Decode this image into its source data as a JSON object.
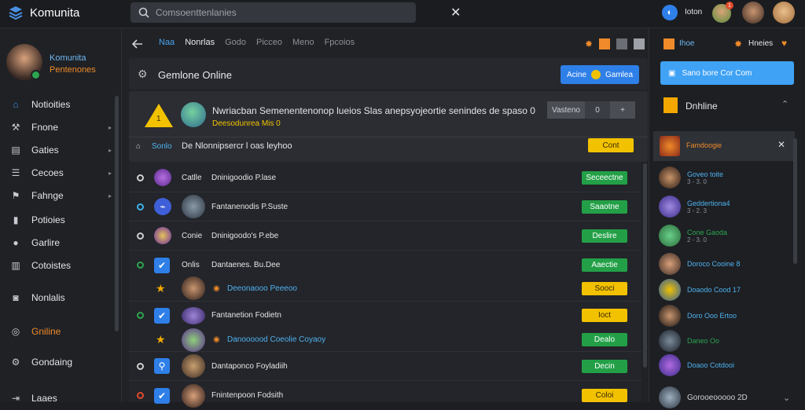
{
  "app": {
    "title": "Komunita"
  },
  "search": {
    "placeholder": "Comsoenttenlanies"
  },
  "top": {
    "user_label": "Ioton",
    "badge": "1"
  },
  "sidebar": {
    "profile": {
      "name": "Komunita",
      "sub": "Pentenones"
    },
    "items": [
      {
        "label": "Notioities",
        "icon": "home-icon"
      },
      {
        "label": "Fnone",
        "icon": "tools-icon"
      },
      {
        "label": "Gaties",
        "icon": "file-icon"
      },
      {
        "label": "Cecoes",
        "icon": "list-icon"
      },
      {
        "label": "Fahnge",
        "icon": "flag-icon"
      },
      {
        "label": "Potioies",
        "icon": "document-icon"
      },
      {
        "label": "Garlire",
        "icon": "drop-icon"
      },
      {
        "label": "Cotoistes",
        "icon": "folder-icon"
      },
      {
        "label": "Nonlalis",
        "icon": "chat-icon"
      },
      {
        "label": "Gniline",
        "icon": "globe-icon"
      },
      {
        "label": "Gondaing",
        "icon": "gear-icon"
      },
      {
        "label": "Laaes",
        "icon": "exit-icon"
      }
    ]
  },
  "main": {
    "tabs": [
      "Naa",
      "Nonrlas",
      "Godo",
      "Picceo",
      "Meno",
      "Fpcoios"
    ],
    "header": {
      "title": "Gemlone Online",
      "button": "Acine",
      "button_suffix": "Gamlea"
    },
    "featured": {
      "title": "Nwriacban Semenentenonop lueios Slas anepsyojeortie senindes de spaso 0",
      "sub": "Deesodunrea Mis 0",
      "stepper": {
        "left": "Vasteno",
        "value": "0",
        "right": "+"
      },
      "badge": "1"
    },
    "infoline": {
      "label": "Sonlo",
      "text": "De Nlonnipsercr l oas leyhoo",
      "btn": "Cont"
    },
    "rows": [
      {
        "title": "Catlle",
        "desc": "Dninigoodio P.lase",
        "btn": "Seceectne",
        "btn_color": "green",
        "marker": "ring"
      },
      {
        "title": "",
        "desc": "Fantanenodis P.Suste",
        "btn": "Saaotne",
        "btn_color": "green",
        "marker": "ring-blue"
      },
      {
        "title": "Conie",
        "desc": "Dninigoodo's P.ebe",
        "btn": "Deslire",
        "btn_color": "green",
        "marker": "ring"
      },
      {
        "title": "Onlis",
        "desc": "Dantaenes. Bu.Dee",
        "btn": "Aaectie",
        "btn_color": "green",
        "marker": "ring-green"
      },
      {
        "title": "",
        "desc": "Deeonaooo Peeeoo",
        "btn": "Sooci",
        "btn_color": "yellow",
        "marker": "star"
      },
      {
        "title": "",
        "desc": "Fantanetion Fodietn",
        "btn": "Ioct",
        "btn_color": "yellow",
        "marker": "ring-green"
      },
      {
        "title": "",
        "desc": "Danoooood Coeolie Coyaoy",
        "btn": "Dealo",
        "btn_color": "green",
        "marker": "star"
      },
      {
        "title": "",
        "desc": "Dantaponco Foyladiih",
        "btn": "Decin",
        "btn_color": "green",
        "marker": "ring"
      },
      {
        "title": "",
        "desc": "Fnintenpoon Fodsith",
        "btn": "Coloi",
        "btn_color": "yellow",
        "marker": "ring-red"
      }
    ]
  },
  "right": {
    "header": {
      "label": "Ihoe",
      "label2": "Hneies"
    },
    "cta": "Sano bore Cor Com",
    "section": {
      "title": "Dnhline"
    },
    "selected": {
      "title": "Famdoogie"
    },
    "contacts": [
      {
        "name": "Goveo toite",
        "sub": "3 - 3. 0"
      },
      {
        "name": "Geddertiona4",
        "sub": "3 - 2. 3"
      },
      {
        "name": "Cone Gaoda",
        "sub": "2 - 3. 0"
      },
      {
        "name": "Doroco Cooine 8",
        "sub": ""
      },
      {
        "name": "Doaodo Cood 17",
        "sub": ""
      },
      {
        "name": "Doro Ooo Ertoo",
        "sub": ""
      },
      {
        "name": "Daneo Oo",
        "sub": ""
      },
      {
        "name": "Doaoo Cotdooi",
        "sub": ""
      },
      {
        "name": "Gorooeooooo 2D",
        "sub": ""
      }
    ]
  }
}
